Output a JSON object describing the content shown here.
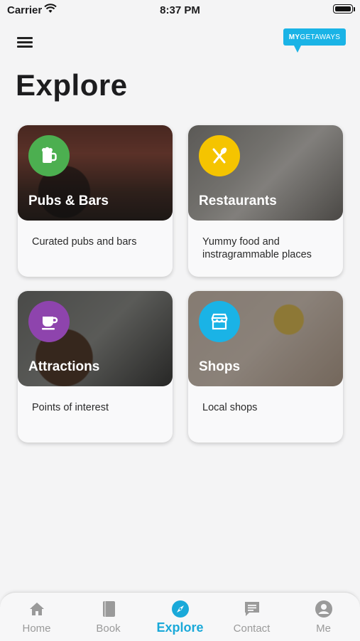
{
  "status_bar": {
    "carrier": "Carrier",
    "time": "8:37 PM"
  },
  "header": {
    "logo": {
      "prefix": "MY",
      "text": "GETAWAYS"
    }
  },
  "page_title": "Explore",
  "categories": [
    {
      "title": "Pubs & Bars",
      "description": "Curated pubs and bars",
      "icon": "beer-mug-icon",
      "icon_color": "#4caf50"
    },
    {
      "title": "Restaurants",
      "description": "Yummy food and instragrammable places",
      "icon": "fork-spoon-icon",
      "icon_color": "#f5c400"
    },
    {
      "title": "Attractions",
      "description": "Points of interest",
      "icon": "coffee-cup-icon",
      "icon_color": "#8e44ad"
    },
    {
      "title": "Shops",
      "description": "Local shops",
      "icon": "storefront-icon",
      "icon_color": "#1ab3e6"
    }
  ],
  "tab_bar": {
    "active_color": "#1aa9d9",
    "tabs": [
      {
        "label": "Home",
        "icon": "home-icon",
        "active": false
      },
      {
        "label": "Book",
        "icon": "book-icon",
        "active": false
      },
      {
        "label": "Explore",
        "icon": "compass-icon",
        "active": true
      },
      {
        "label": "Contact",
        "icon": "chat-icon",
        "active": false
      },
      {
        "label": "Me",
        "icon": "user-circle-icon",
        "active": false
      }
    ]
  }
}
